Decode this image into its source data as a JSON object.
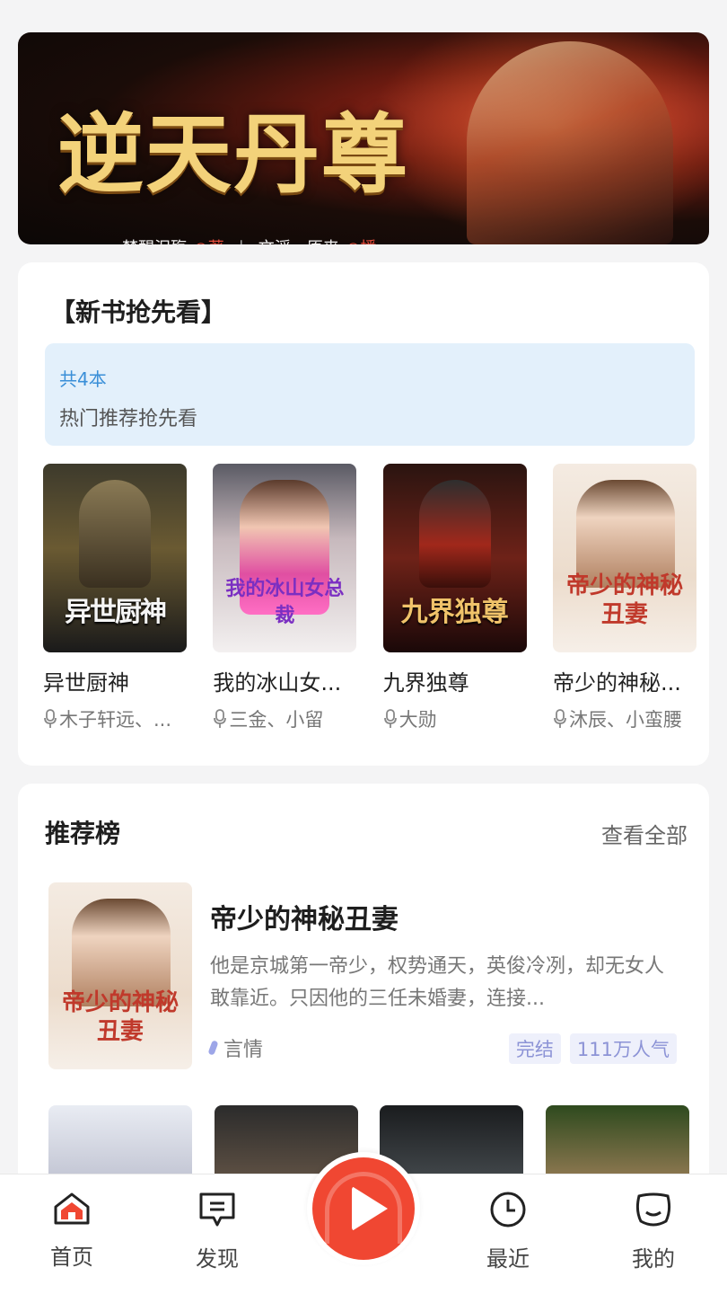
{
  "banner": {
    "title": "逆天丹尊",
    "author": "梦醒泪殇",
    "author_suffix": "◎著",
    "narrators": "文滔、原来",
    "narrator_suffix": "◎播"
  },
  "new_books": {
    "heading": "【新书抢先看】",
    "count_text": "共4本",
    "description": "热门推荐抢先看",
    "books": [
      {
        "title": "异世厨神",
        "author": "木子轩远、...",
        "cover_text": "异世厨神"
      },
      {
        "title": "我的冰山女...",
        "author": "三金、小留",
        "cover_text": "我的冰山女总裁"
      },
      {
        "title": "九界独尊",
        "author": "大勋",
        "cover_text": "九界独尊"
      },
      {
        "title": "帝少的神秘...",
        "author": "沐辰、小蛮腰",
        "cover_text": "帝少的神秘丑妻"
      }
    ]
  },
  "recommend": {
    "heading": "推荐榜",
    "more_label": "查看全部",
    "featured": {
      "title": "帝少的神秘丑妻",
      "description": "他是京城第一帝少，权势通天，英俊冷冽，却无女人敢靠近。只因他的三任未婚妻，连接...",
      "genre": "言情",
      "status_tag": "完结",
      "popularity_tag": "111万人气",
      "cover_text": "帝少的神秘丑妻"
    }
  },
  "nav": {
    "home": "首页",
    "discover": "发现",
    "recent": "最近",
    "mine": "我的"
  },
  "colors": {
    "accent": "#f04732",
    "info_bg": "#e3f0fb",
    "info_text": "#3a8fd8",
    "tag_text": "#8c93d6"
  }
}
